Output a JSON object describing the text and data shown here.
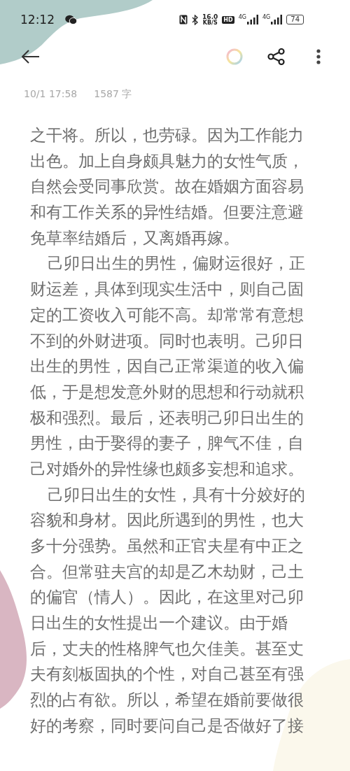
{
  "status_bar": {
    "time": "12:12",
    "speed_value": "16.0",
    "speed_unit": "KB/S",
    "hd": "HD",
    "networks": [
      "4G",
      "4G"
    ],
    "battery": "74"
  },
  "note": {
    "date": "10/1 17:58",
    "word_count": "1587 字",
    "paragraphs": [
      {
        "indent": false,
        "lines": [
          "之干将。所以，也劳碌。因为工作能力",
          "出色。加上自身颇具魅力的女性气质，",
          "自然会受同事欣赏。故在婚姻方面容易",
          "和有工作关系的异性结婚。但要注意避",
          "免草率结婚后，又离婚再嫁。"
        ]
      },
      {
        "indent": true,
        "lines": [
          "己卯日出生的男性，偏财运很好，正",
          "财运差，具体到现实生活中，则自己固",
          "定的工资收入可能不高。却常常有意想",
          "不到的外财进项。同时也表明。己卯日",
          "出生的男性，因自己正常渠道的收入偏",
          "低，于是想发意外财的思想和行动就积",
          "极和强烈。最后，还表明己卯日出生的",
          "男性，由于娶得的妻子，脾气不佳，自",
          "己对婚外的异性缘也颇多妄想和追求。"
        ]
      },
      {
        "indent": true,
        "lines": [
          "己卯日出生的女性，具有十分姣好的",
          "容貌和身材。因此所遇到的男性，也大",
          "多十分强势。虽然和正官夫星有中正之",
          "合。但常驻夫宫的却是乙木劫财，己土",
          "的偏官（情人）。因此，在这里对己卯",
          "日出生的女性提出一个建议。由于婚",
          "后，丈夫的性格脾气也欠佳美。甚至丈",
          "夫有刻板固执的个性，对自己甚至有强",
          "烈的占有欲。所以，希望在婚前要做很",
          "好的考察，同时要问自己是否做好了接"
        ]
      }
    ]
  }
}
